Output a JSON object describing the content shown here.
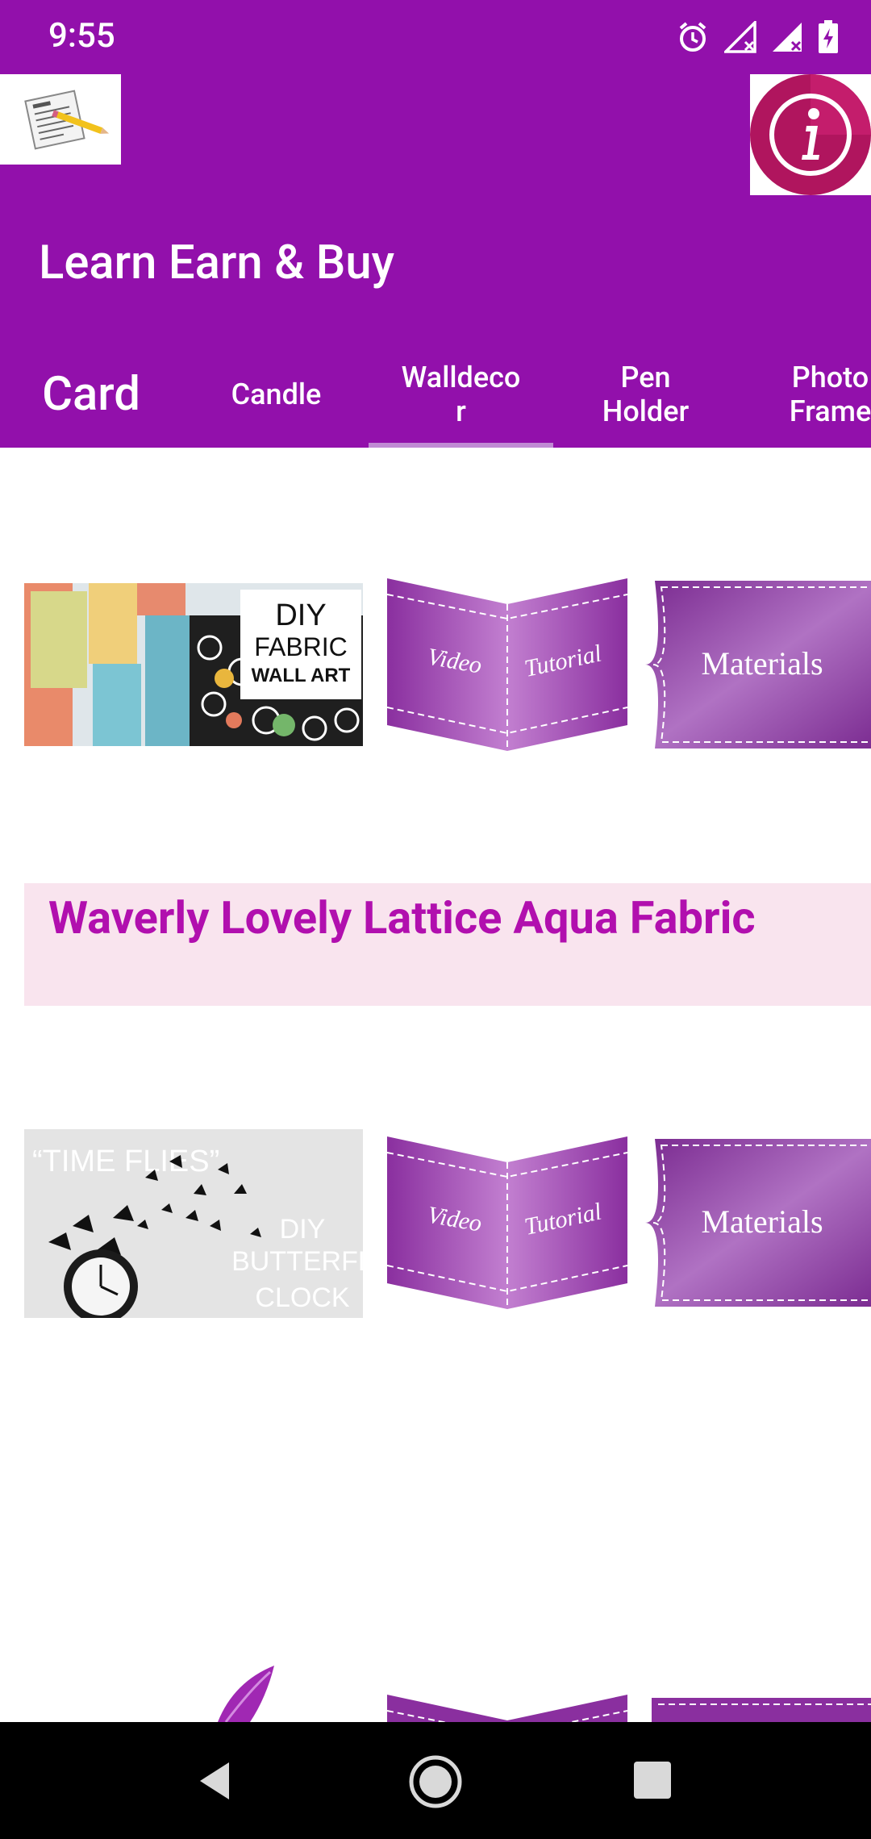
{
  "status": {
    "time": "9:55"
  },
  "app": {
    "title": "Learn Earn & Buy",
    "logo_icon": "notepad-pencil-icon",
    "info_icon": "info-icon"
  },
  "tabs": [
    {
      "label": "Card",
      "selected": false
    },
    {
      "label": "Candle",
      "selected": false
    },
    {
      "label": "Walldeco\nr",
      "selected": true
    },
    {
      "label": "Pen\nHolder",
      "selected": false
    },
    {
      "label": "Photo\nFrame",
      "selected": false
    }
  ],
  "content": {
    "rows": [
      {
        "thumb_text": [
          "DIY",
          "FABRIC",
          "WALL ART"
        ],
        "video_labels": [
          "Video",
          "Tutorial"
        ],
        "materials_label": "Materials"
      },
      {
        "thumb_text": [
          "“TIME FLIES”",
          "DIY",
          "BUTTERFLY",
          "CLOCK"
        ],
        "video_labels": [
          "Video",
          "Tutorial"
        ],
        "materials_label": "Materials"
      }
    ],
    "banner": "Waverly Lovely Lattice Aqua Fabric"
  },
  "colors": {
    "primary": "#9210ab",
    "banner_bg": "#f9e4ee",
    "banner_text": "#b10fae"
  }
}
